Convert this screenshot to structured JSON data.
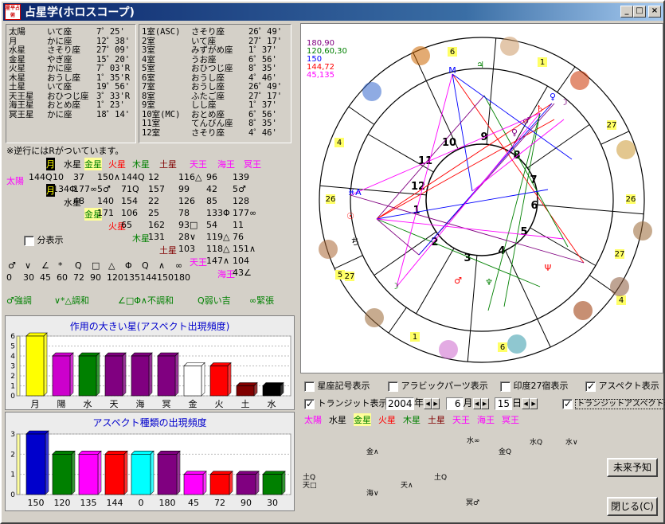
{
  "window": {
    "title": "占星学(ホロスコープ)",
    "icon_text": "星平占術",
    "min": "_",
    "max": "□",
    "close": "×"
  },
  "planets": [
    {
      "name": "太陽",
      "sign": "いて座",
      "deg": "7゜25'"
    },
    {
      "name": "月",
      "sign": "かに座",
      "deg": "12゜38'"
    },
    {
      "name": "水星",
      "sign": "さそり座",
      "deg": "27゜09'"
    },
    {
      "name": "金星",
      "sign": "やぎ座",
      "deg": "15゜20'"
    },
    {
      "name": "火星",
      "sign": "かに座",
      "deg": "7゜03'R"
    },
    {
      "name": "木星",
      "sign": "おうし座",
      "deg": "1゜35'R"
    },
    {
      "name": "土星",
      "sign": "いて座",
      "deg": "19゜56'"
    },
    {
      "name": "天王星",
      "sign": "おひつじ座",
      "deg": "3゜33'R"
    },
    {
      "name": "海王星",
      "sign": "おとめ座",
      "deg": "1゜23'"
    },
    {
      "name": "冥王星",
      "sign": "かに座",
      "deg": "18゜14'"
    }
  ],
  "houses": [
    {
      "name": "1室(ASC)",
      "sign": "さそり座",
      "deg": "26゜49'"
    },
    {
      "name": "2室",
      "sign": "いて座",
      "deg": "27゜17'"
    },
    {
      "name": "3室",
      "sign": "みずがめ座",
      "deg": "1゜37'"
    },
    {
      "name": "4室",
      "sign": "うお座",
      "deg": "6゜56'"
    },
    {
      "name": "5室",
      "sign": "おひつじ座",
      "deg": "8゜35'"
    },
    {
      "name": "6室",
      "sign": "おうし座",
      "deg": "4゜46'"
    },
    {
      "name": "7室",
      "sign": "おうし座",
      "deg": "26゜49'"
    },
    {
      "name": "8室",
      "sign": "ふたご座",
      "deg": "27゜17'"
    },
    {
      "name": "9室",
      "sign": "しし座",
      "deg": "1゜37'"
    },
    {
      "name": "10室(MC)",
      "sign": "おとめ座",
      "deg": "6゜56'"
    },
    {
      "name": "11室",
      "sign": "てんびん座",
      "deg": "8゜35'"
    },
    {
      "name": "12室",
      "sign": "さそり座",
      "deg": "4゜46'"
    }
  ],
  "retro_note": "※逆行にはRがついています。",
  "aspect_header": [
    "月",
    "水星",
    "金星",
    "火星",
    "木星",
    "土星",
    "天王",
    "海王",
    "冥王"
  ],
  "aspect_rows": [
    {
      "label": "太陽",
      "cells": [
        "144Q",
        "10",
        "37",
        "150∧",
        "144Q",
        "12",
        "116△",
        "96",
        "139"
      ]
    },
    {
      "label": "月",
      "cells": [
        "134Φ",
        "177∞",
        "5♂",
        "71Q",
        "157",
        "99",
        "42",
        "5♂"
      ]
    },
    {
      "label": "水星",
      "cells": [
        "48",
        "140",
        "154",
        "22",
        "126",
        "85",
        "128"
      ]
    },
    {
      "label": "金星",
      "cells": [
        "171",
        "106",
        "25",
        "78",
        "133Φ",
        "177∞"
      ]
    },
    {
      "label": "火星",
      "cells": [
        "65",
        "162",
        "93□",
        "54",
        "11"
      ]
    },
    {
      "label": "木星",
      "cells": [
        "131",
        "28∨",
        "119△",
        "76"
      ]
    },
    {
      "label": "土星",
      "cells": [
        "103",
        "118△",
        "151∧"
      ]
    },
    {
      "label": "天王",
      "cells": [
        "147∧",
        "104"
      ]
    },
    {
      "label": "海王",
      "cells": [
        "43∠"
      ]
    }
  ],
  "split_label": "分表示",
  "aspect_symbols": [
    "♂",
    "∨",
    "∠",
    "*",
    "Q",
    "□",
    "△",
    "Φ",
    "Q",
    "∧",
    "∞"
  ],
  "aspect_degrees": [
    "0",
    "30",
    "45",
    "60",
    "72",
    "90",
    "120",
    "135",
    "144",
    "150",
    "180"
  ],
  "aspect_key": [
    "♂強調",
    "∨*△調和",
    "∠□Φ∧不調和",
    "Q弱い吉",
    "∞緊張"
  ],
  "chart1": {
    "title": "作用の大きい星(アスペクト出現頻度)",
    "ymax": 6,
    "categories": [
      "月",
      "陽",
      "水",
      "天",
      "海",
      "冥",
      "金",
      "火",
      "土",
      "水"
    ],
    "values": [
      6,
      4,
      4,
      4,
      4,
      4,
      3,
      3,
      1,
      1
    ],
    "colors": [
      "#ffff00",
      "#cc00cc",
      "#008000",
      "#800080",
      "#800080",
      "#800080",
      "#ffffff",
      "#ff0000",
      "#800000",
      "#000000"
    ]
  },
  "chart2": {
    "title": "アスペクト種類の出現頻度",
    "ymax": 3,
    "categories": [
      "150",
      "120",
      "135",
      "144",
      "0",
      "180",
      "45",
      "72",
      "90",
      "30"
    ],
    "values": [
      3,
      2,
      2,
      2,
      2,
      2,
      1,
      1,
      1,
      1
    ],
    "colors": [
      "#0000cc",
      "#008000",
      "#ff00ff",
      "#ff0000",
      "#00ffff",
      "#800080",
      "#ff00ff",
      "#ff0000",
      "#800080",
      "#008000"
    ]
  },
  "wheel_legend": [
    {
      "t": "180,90",
      "c": "#800080"
    },
    {
      "t": "120,60,30",
      "c": "#008000"
    },
    {
      "t": "150",
      "c": "#0000ff"
    },
    {
      "t": "144,72",
      "c": "#ff0000"
    },
    {
      "t": "45,135",
      "c": "#ff00ff"
    }
  ],
  "house_nums": [
    "1",
    "2",
    "3",
    "4",
    "5",
    "6",
    "7",
    "8",
    "9",
    "10",
    "11",
    "12"
  ],
  "zodiac_numbers": [
    "6",
    "1",
    "27",
    "4",
    "26",
    "26",
    "5",
    "27",
    "1",
    "6",
    "4",
    "27"
  ],
  "options": {
    "sign_symbols": "星座記号表示",
    "arabic_parts": "アラビックパーツ表示",
    "indian_27": "印度27宿表示",
    "aspect_show": "アスペクト表示",
    "transit": "トランジット表示",
    "transit_aspect": "トランジットアスペクト表示"
  },
  "date": {
    "year": "2004",
    "year_unit": "年",
    "month": "6",
    "month_unit": "月",
    "day": "15",
    "day_unit": "日"
  },
  "transit_planets": [
    {
      "t": "太陽",
      "c": "#ff00ff"
    },
    {
      "t": "水星",
      "c": "#000000"
    },
    {
      "t": "金星",
      "c": "#008000",
      "bg": "#ffff99"
    },
    {
      "t": "火星",
      "c": "#ff0000"
    },
    {
      "t": "木星",
      "c": "#008000"
    },
    {
      "t": "土星",
      "c": "#800000"
    },
    {
      "t": "天王",
      "c": "#ff00ff"
    },
    {
      "t": "海王",
      "c": "#ff00ff"
    },
    {
      "t": "冥王",
      "c": "#ff00ff"
    }
  ],
  "transit_marks": [
    "水∞",
    "水Q",
    "水∨",
    "金∧",
    "金Q",
    "土Q",
    "天□",
    "土Q",
    "天∧",
    "海∨",
    "冥♂"
  ],
  "buttons": {
    "future": "未来予知",
    "close": "閉じる(C)"
  }
}
